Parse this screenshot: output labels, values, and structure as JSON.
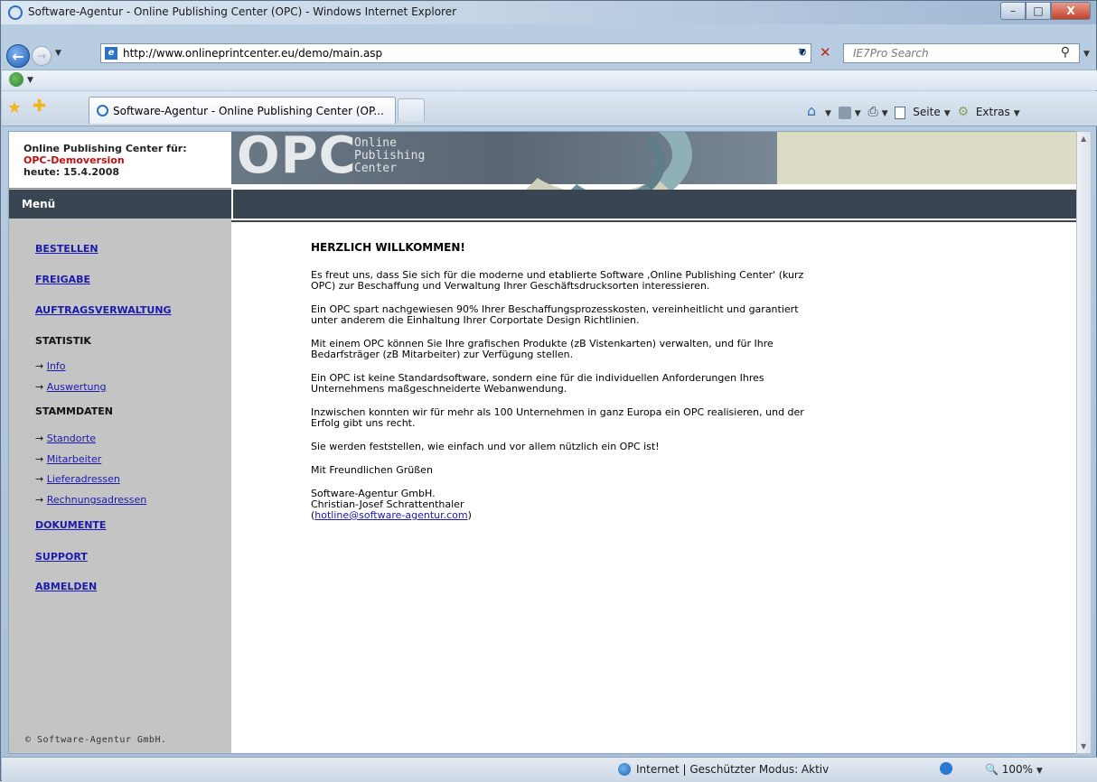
{
  "window": {
    "title": "Software-Agentur - Online Publishing Center (OPC) - Windows Internet Explorer",
    "min_label": "–",
    "max_label": "□",
    "close_label": "X"
  },
  "address": {
    "url": "http://www.onlineprintcenter.eu/demo/main.asp",
    "search_placeholder": "IE7Pro Search"
  },
  "tab": {
    "label": "Software-Agentur - Online Publishing Center (OP..."
  },
  "command_bar": {
    "page_label": "Seite",
    "extras_label": "Extras"
  },
  "site": {
    "header_line1": "Online Publishing Center für:",
    "header_line2": "OPC-Demoversion",
    "header_line3": "heute: 15.4.2008",
    "logo_text": "OPC",
    "logo_sub1": "Online",
    "logo_sub2": "Publishing",
    "logo_sub3": "Center",
    "menu_title": "Menü",
    "copyright": "© Software-Agentur GmbH."
  },
  "menu": {
    "bestellen": "BESTELLEN",
    "freigabe": "FREIGABE",
    "auftragsverwaltung": "AUFTRAGSVERWALTUNG",
    "statistik": "STATISTIK",
    "info": "Info",
    "auswertung": "Auswertung",
    "stammdaten": "STAMMDATEN",
    "standorte": "Standorte",
    "mitarbeiter": "Mitarbeiter",
    "lieferadressen": "Lieferadressen",
    "rechnungsadressen": "Rechnungsadressen",
    "dokumente": "DOKUMENTE",
    "support": "SUPPORT",
    "abmelden": "ABMELDEN",
    "arrow": "→"
  },
  "content": {
    "heading": "HERZLICH WILLKOMMEN!",
    "p1": "Es freut uns, dass Sie sich für die moderne und etablierte Software ‚Online Publishing Center' (kurz OPC) zur Beschaffung und Verwaltung Ihrer Geschäftsdrucksorten interessieren.",
    "p2": "Ein OPC spart nachgewiesen 90% Ihrer Beschaffungsprozesskosten, vereinheitlicht und garantiert unter anderem die Einhaltung Ihrer Corportate Design Richtlinien.",
    "p3": "Mit einem OPC können Sie Ihre grafischen Produkte (zB Vistenkarten) verwalten, und für Ihre Bedarfsträger (zB Mitarbeiter) zur Verfügung stellen.",
    "p4": "Ein OPC ist keine Standardsoftware, sondern eine für die individuellen Anforderungen Ihres Unternehmens maßgeschneiderte Webanwendung.",
    "p5": "Inzwischen konnten wir für mehr als 100 Unternehmen in ganz Europa ein OPC realisieren, und der Erfolg gibt uns recht.",
    "p6": "Sie werden feststellen, wie einfach und vor allem nützlich ein OPC ist!",
    "p7": "Mit Freundlichen Grüßen",
    "sig1": "Software-Agentur GmbH.",
    "sig2": "Christian-Josef Schrattenthaler",
    "email": "hotline@software-agentur.com",
    "paren_open": "(",
    "paren_close": ")"
  },
  "status": {
    "zone": "Internet | Geschützter Modus: Aktiv",
    "zoom": "100%"
  }
}
